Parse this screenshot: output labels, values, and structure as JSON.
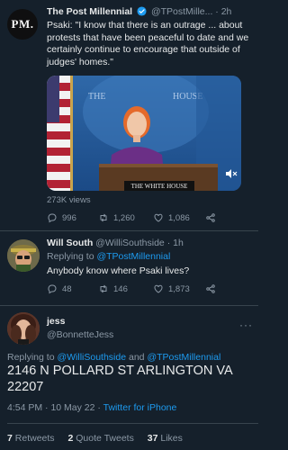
{
  "tweet1": {
    "avatar_text": "PM.",
    "name": "The Post Millennial",
    "handle": "@TPostMille...",
    "separator": "·",
    "time": "2h",
    "text": "Psaki: \"I know that there is an outrage ... about protests that have been peaceful to date and we certainly continue to encourage that outside of judges' homes.\"",
    "media": {
      "wall_left": "THE",
      "wall_right": "HOUSE",
      "podium_sign": "THE WHITE HOUSE"
    },
    "views": "273K views",
    "reply_count": "996",
    "retweet_count": "1,260",
    "like_count": "1,086"
  },
  "tweet2": {
    "name": "Will South",
    "handle": "@WilliSouthside",
    "separator": "·",
    "time": "1h",
    "replying_prefix": "Replying to",
    "replying_to": "@TPostMillennial",
    "text": "Anybody know where Psaki lives?",
    "reply_count": "48",
    "retweet_count": "146",
    "like_count": "1,873"
  },
  "tweet3": {
    "name": "jess",
    "handle": "@BonnetteJess",
    "replying_prefix": "Replying to",
    "replying_to_1": "@WilliSouthside",
    "replying_and": "and",
    "replying_to_2": "@TPostMillennial",
    "text": "2146 N POLLARD ST ARLINGTON VA 22207",
    "time": "4:54 PM",
    "separator": "·",
    "date": "10 May 22",
    "source": "Twitter for iPhone",
    "retweets_count": "7",
    "retweets_label": "Retweets",
    "quotes_count": "2",
    "quotes_label": "Quote Tweets",
    "likes_count": "37",
    "likes_label": "Likes"
  },
  "colors": {
    "background": "#15202b",
    "text": "#e7e9ea",
    "secondary": "#8b98a5",
    "accent": "#1d9bf0",
    "divider": "#38444d"
  }
}
